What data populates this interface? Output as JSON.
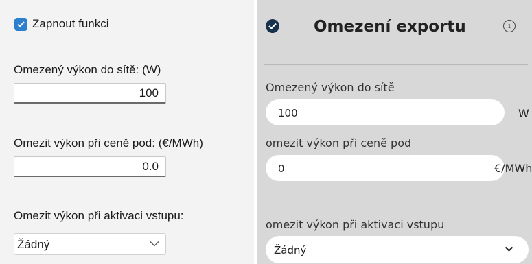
{
  "left": {
    "enable_label": "Zapnout funkci",
    "enable_checked": true,
    "limit_label": "Omezený výkon do sítě: (W)",
    "limit_value": "100",
    "price_label": "Omezit výkon při ceně pod: (€/MWh)",
    "price_value": "0.0",
    "input_label": "Omezit výkon při aktivaci vstupu:",
    "input_value": "Žádný"
  },
  "right": {
    "title": "Omezení exportu",
    "info_glyph": "i",
    "limit_label": "Omezený výkon do sítě",
    "limit_value": "100",
    "limit_unit": "W",
    "price_label": "omezit výkon při ceně pod",
    "price_value": "0",
    "price_unit": "€/MWh",
    "input_label": "omezit výkon při aktivaci vstupu",
    "input_value": "Žádný"
  },
  "colors": {
    "checkbox_accent": "#2f7fcf",
    "ha_check": "#17304e",
    "right_panel_bg": "#d8d8d8"
  }
}
